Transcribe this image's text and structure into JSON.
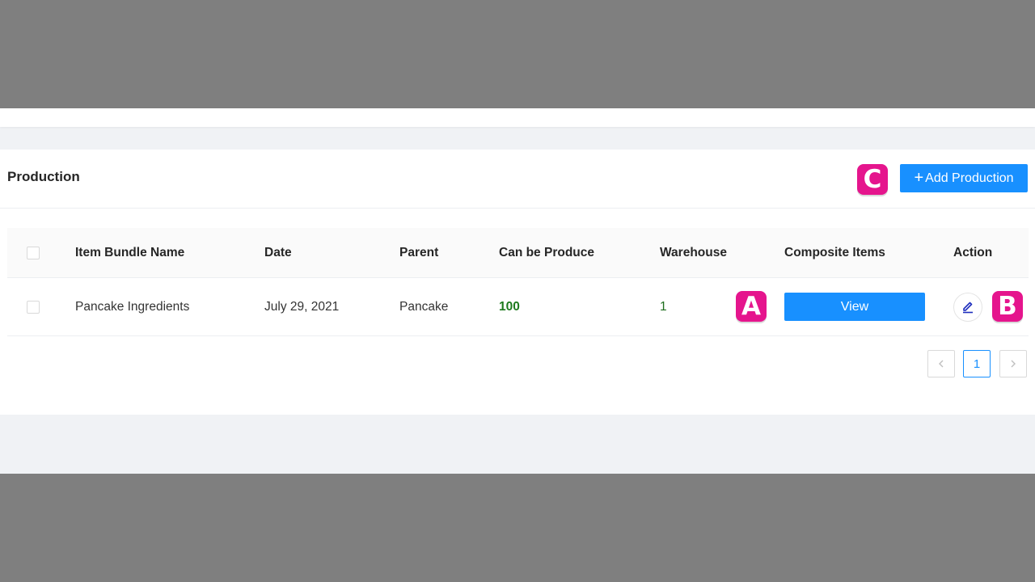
{
  "card": {
    "title": "Production",
    "add_button": "Add Production"
  },
  "table": {
    "headers": [
      "Item Bundle Name",
      "Date",
      "Parent",
      "Can be Produce",
      "Warehouse",
      "Composite Items",
      "Action"
    ],
    "rows": [
      {
        "name": "Pancake Ingredients",
        "date": "July 29, 2021",
        "parent": "Pancake",
        "can_produce": "100",
        "warehouse": "1",
        "composite_button": "View"
      }
    ]
  },
  "pagination": {
    "current_page": "1"
  },
  "markers": [
    "A",
    "B",
    "C"
  ],
  "icons": [
    "plus-icon",
    "edit-icon",
    "chevron-left-icon",
    "chevron-right-icon"
  ],
  "colors": {
    "primary": "#1890ff",
    "marker": "#e5158d",
    "produce_value": "#1e7a1e",
    "background": "#f0f2f5"
  }
}
